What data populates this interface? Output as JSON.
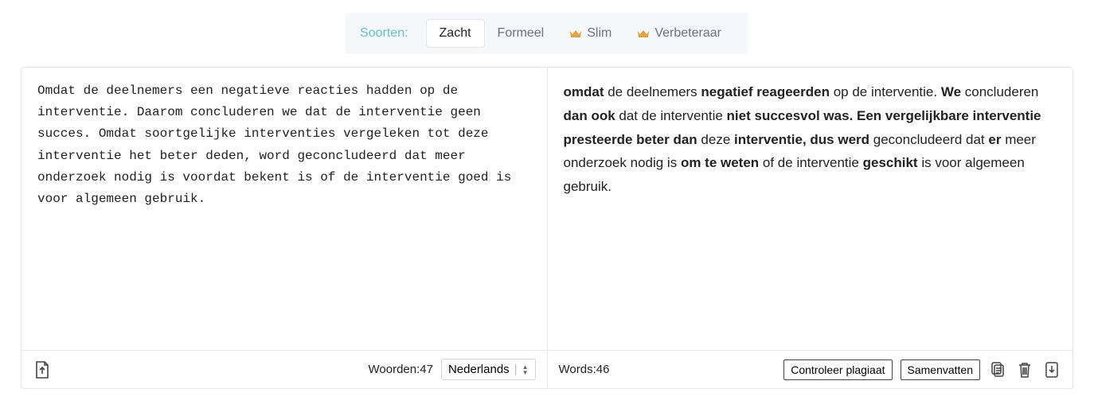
{
  "toolbar": {
    "label": "Soorten:",
    "tabs": [
      {
        "label": "Zacht",
        "premium": false,
        "active": true
      },
      {
        "label": "Formeel",
        "premium": false,
        "active": false
      },
      {
        "label": "Slim",
        "premium": true,
        "active": false
      },
      {
        "label": "Verbeteraar",
        "premium": true,
        "active": false
      }
    ]
  },
  "left": {
    "text": "Omdat de deelnemers een negatieve reacties hadden op de interventie. Daarom concluderen we dat de interventie geen succes. Omdat soortgelijke interventies vergeleken tot deze interventie het beter deden, word geconcludeerd dat meer onderzoek nodig is voordat bekent is of de interventie goed is voor algemeen gebruik.",
    "word_label": "Woorden:",
    "word_count": "47",
    "language": "Nederlands"
  },
  "right": {
    "segments": [
      {
        "t": "omdat",
        "b": true
      },
      {
        "t": " de deelnemers ",
        "b": false
      },
      {
        "t": "negatief reageerden",
        "b": true
      },
      {
        "t": " op de interventie. ",
        "b": false
      },
      {
        "t": "We",
        "b": true
      },
      {
        "t": " concluderen ",
        "b": false
      },
      {
        "t": "dan ook",
        "b": true
      },
      {
        "t": " dat de interventie ",
        "b": false
      },
      {
        "t": "niet succesvol was. Een vergelijkbare interventie presteerde beter dan",
        "b": true
      },
      {
        "t": " deze ",
        "b": false
      },
      {
        "t": "interventie, dus werd",
        "b": true
      },
      {
        "t": " geconcludeerd dat ",
        "b": false
      },
      {
        "t": "er",
        "b": true
      },
      {
        "t": " meer onderzoek nodig is ",
        "b": false
      },
      {
        "t": "om te weten",
        "b": true
      },
      {
        "t": " of de interventie ",
        "b": false
      },
      {
        "t": "geschikt",
        "b": true
      },
      {
        "t": " is voor algemeen gebruik.",
        "b": false
      }
    ],
    "word_label": "Words:",
    "word_count": "46",
    "actions": {
      "plagiarism": "Controleer plagiaat",
      "summarize": "Samenvatten"
    }
  }
}
